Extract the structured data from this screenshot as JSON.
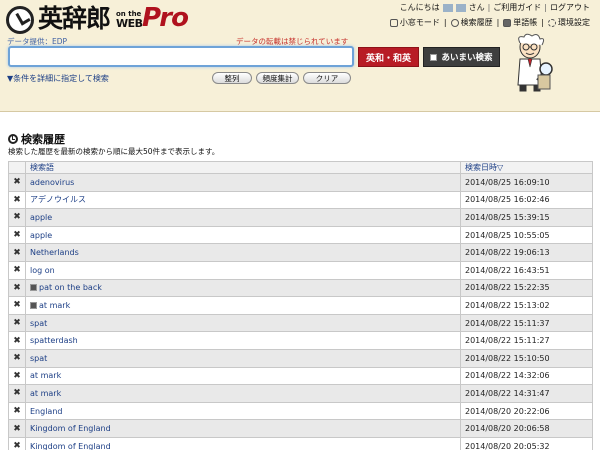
{
  "header": {
    "logo_jp": "英辞郎",
    "logo_onthe": "on the",
    "logo_web": "WEB",
    "logo_pro": "Pro",
    "greeting_prefix": "こんにちは",
    "greeting_suffix": "さん",
    "user_guide": "ご利用ガイド",
    "logout": "ログアウト",
    "separator": "|",
    "subnav": [
      {
        "label": "小窓モード",
        "icon": "window-icon"
      },
      {
        "label": "検索履歴",
        "icon": "clock-icon"
      },
      {
        "label": "単語帳",
        "icon": "book-icon"
      },
      {
        "label": "環境設定",
        "icon": "gear-icon"
      }
    ],
    "data_source": "データ提供：EDP",
    "notice": "データの転載は禁じられています"
  },
  "search": {
    "value": "",
    "en_ja_button": "英和・和英",
    "fuzzy_button": "あいまい検索",
    "advanced_link": "条件を詳細に指定して検索",
    "sort_button": "整列",
    "frequency_button": "頻度集計",
    "clear_button": "クリア"
  },
  "history": {
    "title": "検索履歴",
    "description": "検索した履歴を最新の検索から順に最大50件まで表示します。",
    "columns": [
      "検索語",
      "検索日時▽"
    ],
    "rows": [
      {
        "term": "adenovirus",
        "date": "2014/08/25 16:09:10",
        "has_icon": false
      },
      {
        "term": "アデノウイルス",
        "date": "2014/08/25 16:02:46",
        "has_icon": false
      },
      {
        "term": "apple",
        "date": "2014/08/25 15:39:15",
        "has_icon": false
      },
      {
        "term": "apple",
        "date": "2014/08/25 10:55:05",
        "has_icon": false
      },
      {
        "term": "Netherlands",
        "date": "2014/08/22 19:06:13",
        "has_icon": false
      },
      {
        "term": "log on",
        "date": "2014/08/22 16:43:51",
        "has_icon": false
      },
      {
        "term": "pat on the back",
        "date": "2014/08/22 15:22:35",
        "has_icon": true
      },
      {
        "term": "at mark",
        "date": "2014/08/22 15:13:02",
        "has_icon": true
      },
      {
        "term": "spat",
        "date": "2014/08/22 15:11:37",
        "has_icon": false
      },
      {
        "term": "spatterdash",
        "date": "2014/08/22 15:11:27",
        "has_icon": false
      },
      {
        "term": "spat",
        "date": "2014/08/22 15:10:50",
        "has_icon": false
      },
      {
        "term": "at mark",
        "date": "2014/08/22 14:32:06",
        "has_icon": false
      },
      {
        "term": "at mark",
        "date": "2014/08/22 14:31:47",
        "has_icon": false
      },
      {
        "term": "England",
        "date": "2014/08/20 20:22:06",
        "has_icon": false
      },
      {
        "term": "Kingdom of England",
        "date": "2014/08/20 20:06:58",
        "has_icon": false
      },
      {
        "term": "Kingdom of England",
        "date": "2014/08/20 20:05:32",
        "has_icon": false
      }
    ]
  },
  "colors": {
    "brand_red": "#b81c25",
    "link_blue": "#1d3f86",
    "header_bg": "#f7f0d8"
  }
}
